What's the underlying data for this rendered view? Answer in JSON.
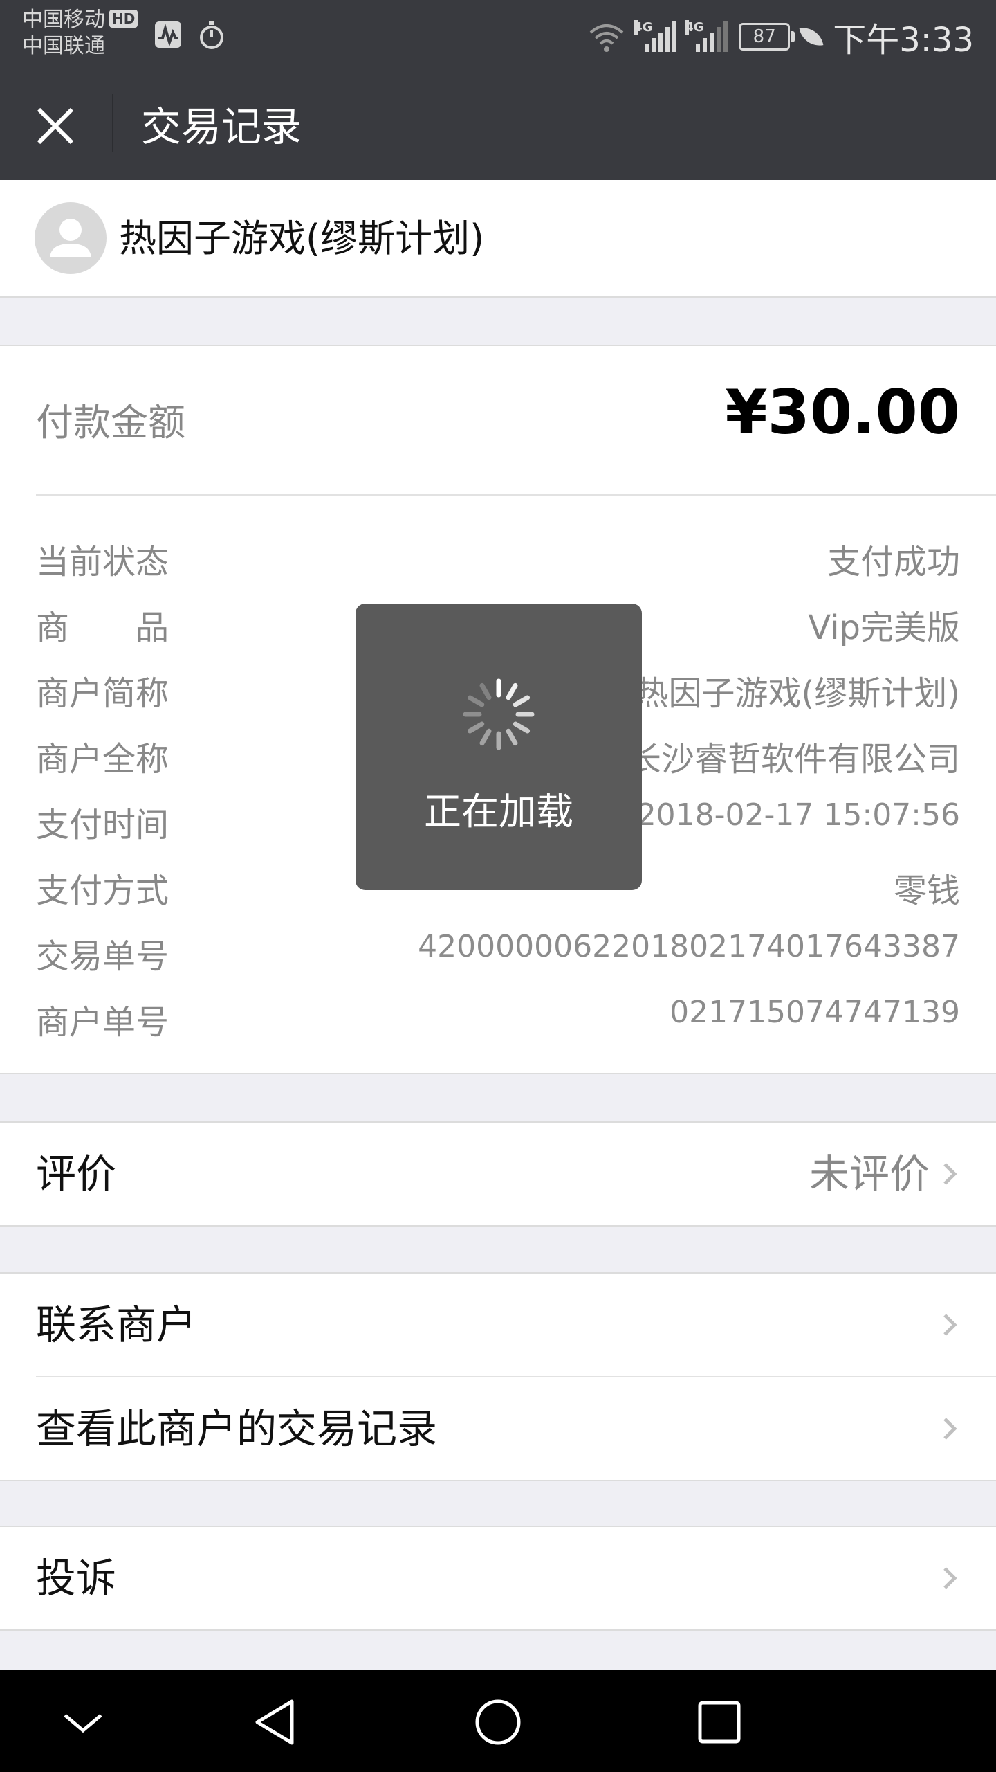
{
  "status_bar": {
    "carrier_1": "中国移动",
    "hd_badge": "HD",
    "carrier_2": "中国联通",
    "network_1": "4G",
    "network_2": "4G",
    "battery": "87",
    "time": "下午3:33"
  },
  "header": {
    "title": "交易记录"
  },
  "merchant": {
    "name": "热因子游戏(缪斯计划)"
  },
  "payment": {
    "amount_label": "付款金额",
    "amount_value": "¥30.00",
    "rows": [
      {
        "label": "当前状态",
        "value": "支付成功"
      },
      {
        "label": "商　　品",
        "value": "Vip完美版"
      },
      {
        "label": "商户简称",
        "value": "热因子游戏(缪斯计划)"
      },
      {
        "label": "商户全称",
        "value": "长沙睿哲软件有限公司"
      },
      {
        "label": "支付时间",
        "value": "2018-02-17 15:07:56"
      },
      {
        "label": "支付方式",
        "value": "零钱"
      },
      {
        "label": "交易单号",
        "value": "4200000062201802174017643387"
      },
      {
        "label": "商户单号",
        "value": "021715074747139"
      }
    ]
  },
  "menu": {
    "review_label": "评价",
    "review_value": "未评价",
    "contact_label": "联系商户",
    "history_label": "查看此商户的交易记录",
    "complaint_label": "投诉"
  },
  "loading": {
    "text": "正在加载"
  },
  "colors": {
    "status_bar": "#393a3f",
    "background": "#efeff4",
    "toast": "#5a5a5a"
  }
}
